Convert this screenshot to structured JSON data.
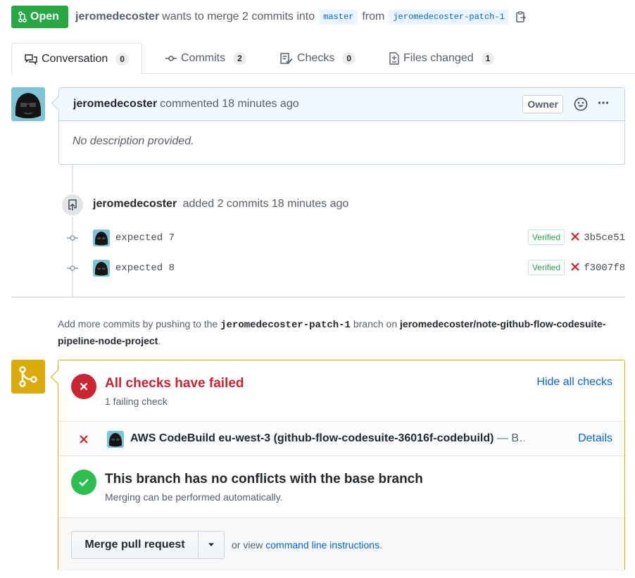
{
  "header": {
    "state": "Open",
    "author": "jeromedecoster",
    "action_text": "wants to merge 2 commits into",
    "base_branch": "master",
    "from_text": "from",
    "head_branch": "jeromedecoster-patch-1"
  },
  "tabs": [
    {
      "label": "Conversation",
      "count": "0"
    },
    {
      "label": "Commits",
      "count": "2"
    },
    {
      "label": "Checks",
      "count": "0"
    },
    {
      "label": "Files changed",
      "count": "1"
    }
  ],
  "comment": {
    "author": "jeromedecoster",
    "action": "commented 18 minutes ago",
    "role_label": "Owner",
    "body": "No description provided."
  },
  "push_event": {
    "author": "jeromedecoster",
    "action": "added 2 commits 18 minutes ago"
  },
  "commits": [
    {
      "message": "expected 7",
      "verified": "Verified",
      "sha": "3b5ce51"
    },
    {
      "message": "expected 8",
      "verified": "Verified",
      "sha": "f3007f8"
    }
  ],
  "push_hint": {
    "prefix": "Add more commits by pushing to the",
    "branch": "jeromedecoster-patch-1",
    "middle": "branch on",
    "repo": "jeromedecoster/note-github-flow-codesuite-pipeline-node-project",
    "suffix": "."
  },
  "checks": {
    "title": "All checks have failed",
    "subtitle": "1 failing check",
    "toggle_label": "Hide all checks",
    "items": [
      {
        "name": "AWS CodeBuild eu-west-3 (github-flow-codesuite-36016f-codebuild)",
        "description": "— B…",
        "details_label": "Details"
      }
    ]
  },
  "conflicts": {
    "title": "This branch has no conflicts with the base branch",
    "subtitle": "Merging can be performed automatically."
  },
  "merge": {
    "button_label": "Merge pull request",
    "or_view_text": "or view",
    "cli_link": "command line instructions",
    "cli_suffix": "."
  },
  "colors": {
    "open_green": "#28a745",
    "fail_red": "#cb2431",
    "link_blue": "#0366d6",
    "pending_yellow": "#dbab09"
  }
}
